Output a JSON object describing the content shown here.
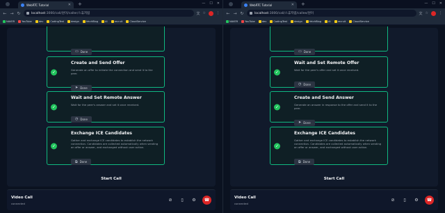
{
  "windows": [
    {
      "id": "left",
      "tab_title": "WebRTC Tutorial",
      "url_host": "localhost",
      "url_path": ":3000/call/원이/caller/스휴저럼",
      "bookmarks": [
        "NAVER",
        "YouTube",
        "dev",
        "CodingTest",
        "design",
        "fetchBlog",
        "AI",
        "recruit",
        "CloudService"
      ],
      "cards": [
        {
          "title": "",
          "desc": "",
          "button": "Done",
          "top": 0
        },
        {
          "title": "Create and Send Offer",
          "desc": "Generate an offer to initiate the connection and send it to the peer.",
          "button": "Done"
        },
        {
          "title": "Wait and Set Remote Answer",
          "desc": "Wait for the peer's answer and set it once received.",
          "button": "Done"
        },
        {
          "title": "Exchange ICE Candidates",
          "desc": "Gather and exchange ICE candidates to establish the network connection. Candidates are collected automatically when sending an offer or answer, and exchanged without user action.",
          "button": "Done"
        }
      ],
      "start_call": "Start Call",
      "footer": {
        "title": "Video Call",
        "status": "connected"
      }
    },
    {
      "id": "right",
      "tab_title": "WebRTC Tutorial",
      "url_host": "localhost",
      "url_path": ":3000/call/스휴저럼/callee/원이",
      "bookmarks": [
        "NAVER",
        "YouTube",
        "dev",
        "CodingTest",
        "design",
        "fetchBlog",
        "AI",
        "recruit",
        "CloudService"
      ],
      "cards": [
        {
          "title": "",
          "desc": "",
          "button": "Done"
        },
        {
          "title": "Wait and Set Remote Offer",
          "desc": "Wait for the peer's offer and set it once received.",
          "button": "Done"
        },
        {
          "title": "Create and Send Answer",
          "desc": "Generate an answer in response to the offer and send it to the peer.",
          "button": "Done"
        },
        {
          "title": "Exchange ICE Candidates",
          "desc": "Gather and exchange ICE candidates to establish the network connection. Candidates are collected automatically when sending an offer or answer, and exchanged without user action.",
          "button": "Done"
        }
      ],
      "start_call": "Start Call",
      "footer": {
        "title": "Video Call",
        "status": "connected"
      }
    }
  ],
  "colors": {
    "accent": "#10b981",
    "check": "#22c55e",
    "hangup": "#dc2626"
  }
}
